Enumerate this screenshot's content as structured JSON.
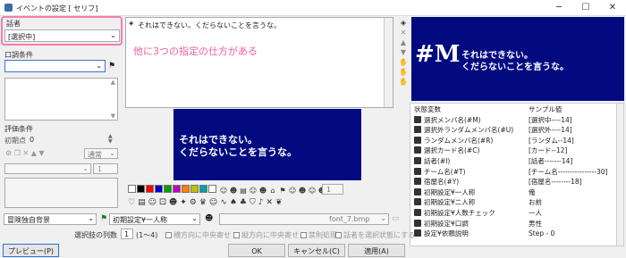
{
  "window": {
    "title": "イベントの設定 [ セリフ]"
  },
  "left": {
    "speaker_label": "話者",
    "speaker_value": "[選択中]",
    "tone_label": "口調条件",
    "eval_label": "評価条件",
    "initial_label": "初期点",
    "initial_value": "0",
    "normal_label": "通常",
    "spin1_value": "1"
  },
  "editor": {
    "text": "それはできない。くだらないことを言うな。",
    "annotation": "他に3つの指定の仕方がある"
  },
  "preview": {
    "line1": "それはできない。",
    "line2": "くだらないことを言うな。",
    "portrait": "#M"
  },
  "toolbar2": {
    "count": "1"
  },
  "bottom": {
    "background": "冒険独自背景",
    "initial_setting": "初期設定¥一人称",
    "font": "font_7.bmp",
    "choices_label": "選択肢の列数",
    "choices_value": "1",
    "choices_range": "(1〜4)",
    "opt1": "横方向に中央寄せ",
    "opt2": "縦方向に中央寄せ",
    "opt3": "禁則処理",
    "opt4": "話者を選択状態にする"
  },
  "buttons": {
    "preview": "プレビュー(P)",
    "ok": "OK",
    "cancel": "キャンセル(C)",
    "apply": "適用(A)"
  },
  "vars": {
    "header": [
      "状態変数",
      "サンプル値"
    ],
    "rows": [
      [
        "選択メンバ名(#M)",
        "[選択中----14]"
      ],
      [
        "選択外ランダムメンバ名(#U)",
        "[選択外----14]"
      ],
      [
        "ランダムメンバ名(#R)",
        "[ランダム--14]"
      ],
      [
        "選択カード名(#C)",
        "[カード--12]"
      ],
      [
        "話者(#I)",
        "[話者-------14]"
      ],
      [
        "チーム名(#T)",
        "[チーム名----------------30]"
      ],
      [
        "宿屋名(#Y)",
        "[宿屋名--------18]"
      ],
      [
        "初期設定¥一人称",
        "俺"
      ],
      [
        "初期設定¥二人称",
        "お前"
      ],
      [
        "初期設定¥人数チェック",
        "一人"
      ],
      [
        "初期設定¥口調",
        "男性"
      ],
      [
        "設定¥依頼説明",
        "Step - 0"
      ]
    ]
  },
  "colors": {
    "accent": "#f07fb0",
    "preview_bg": "#020a80",
    "swatches": [
      "#000000",
      "#ff0000",
      "#0000c8",
      "#00a000",
      "#c000c0",
      "#ff8000",
      "#c0c000",
      "#00a0a0",
      "#ffffff"
    ]
  }
}
